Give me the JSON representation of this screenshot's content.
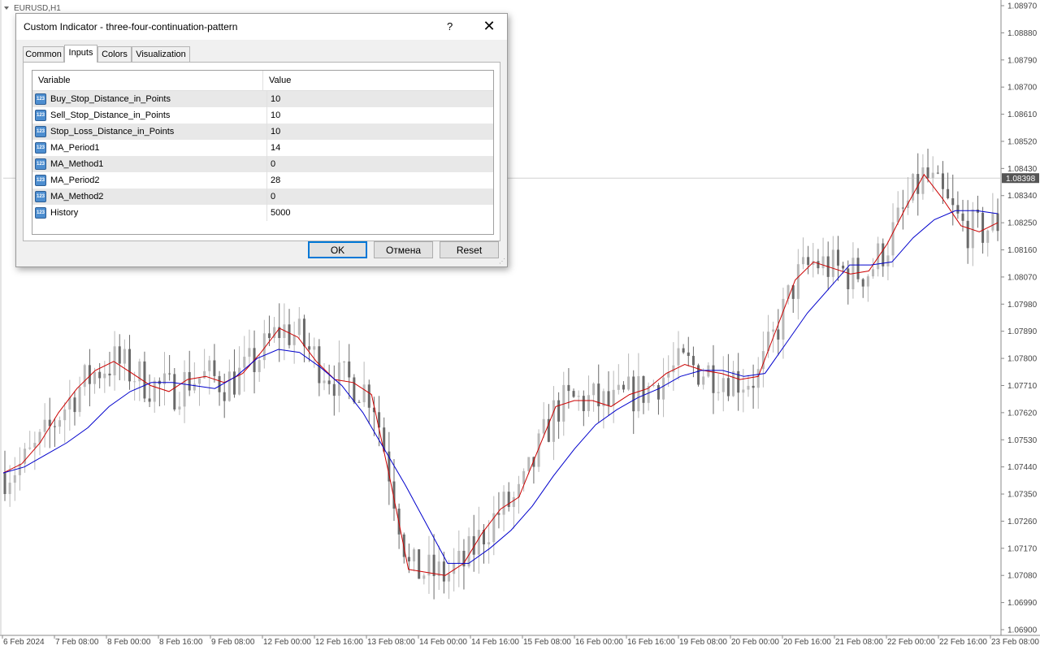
{
  "chart_window": {
    "symbol_label": "EURUSD,H1",
    "current_price": "1.08398",
    "current_price_bg": "#555555",
    "colors": {
      "ma_fast": "#cc0000",
      "ma_slow": "#0000cc",
      "bull_candle": "#b8b8b8",
      "bear_candle": "#6a6a6a",
      "axis_text": "#444444"
    }
  },
  "chart_data": {
    "type": "line",
    "price_axis_labels": [
      "1.08970",
      "1.08880",
      "1.08790",
      "1.08700",
      "1.08610",
      "1.08520",
      "1.08430",
      "1.08340",
      "1.08250",
      "1.08160",
      "1.08070",
      "1.07980",
      "1.07890",
      "1.07800",
      "1.07710",
      "1.07620",
      "1.07530",
      "1.07440",
      "1.07350",
      "1.07260",
      "1.07170",
      "1.07080",
      "1.06990",
      "1.06900"
    ],
    "ylim": [
      1.069,
      1.0897
    ],
    "time_axis_labels": [
      "6 Feb 2024",
      "7 Feb 08:00",
      "8 Feb 00:00",
      "8 Feb 16:00",
      "9 Feb 08:00",
      "12 Feb 00:00",
      "12 Feb 16:00",
      "13 Feb 08:00",
      "14 Feb 00:00",
      "14 Feb 16:00",
      "15 Feb 08:00",
      "16 Feb 00:00",
      "16 Feb 16:00",
      "19 Feb 08:00",
      "20 Feb 00:00",
      "20 Feb 16:00",
      "21 Feb 08:00",
      "22 Feb 00:00",
      "22 Feb 16:00",
      "23 Feb 08:00"
    ],
    "series": [
      {
        "values": [
          1.0742,
          1.0745,
          1.0752,
          1.0762,
          1.077,
          1.0776,
          1.0779,
          1.0775,
          1.0771,
          1.0769,
          1.0773,
          1.0774,
          1.0772,
          1.0775,
          1.0782,
          1.079,
          1.0787,
          1.0779,
          1.0773,
          1.0772,
          1.0768,
          1.074,
          1.071,
          1.0709,
          1.0708,
          1.0712,
          1.0722,
          1.073,
          1.0734,
          1.0749,
          1.0764,
          1.0766,
          1.0766,
          1.0764,
          1.0768,
          1.077,
          1.0775,
          1.0778,
          1.0776,
          1.0775,
          1.0773,
          1.0774,
          1.079,
          1.0806,
          1.0812,
          1.081,
          1.0808,
          1.0809,
          1.0818,
          1.083,
          1.0841,
          1.0833,
          1.0824,
          1.0822,
          1.0825
        ]
      },
      {
        "values": [
          1.0742,
          1.0744,
          1.0748,
          1.0752,
          1.0757,
          1.0764,
          1.0769,
          1.0772,
          1.0772,
          1.0771,
          1.077,
          1.0774,
          1.078,
          1.0783,
          1.0782,
          1.0777,
          1.0771,
          1.0762,
          1.075,
          1.0738,
          1.0725,
          1.0712,
          1.0712,
          1.0717,
          1.0723,
          1.0731,
          1.0741,
          1.075,
          1.0758,
          1.0763,
          1.0767,
          1.077,
          1.0774,
          1.0776,
          1.0776,
          1.0774,
          1.0775,
          1.0785,
          1.0795,
          1.0803,
          1.0811,
          1.0811,
          1.0812,
          1.082,
          1.0826,
          1.0829,
          1.0829,
          1.0828
        ]
      }
    ]
  },
  "dialog": {
    "title": "Custom Indicator - three-four-continuation-pattern",
    "help_label": "?",
    "close_label": "✕",
    "tabs": [
      {
        "label": "Common"
      },
      {
        "label": "Inputs"
      },
      {
        "label": "Colors"
      },
      {
        "label": "Visualization"
      }
    ],
    "active_tab": "Inputs",
    "table": {
      "col_variable": "Variable",
      "col_value": "Value",
      "icon_text": "123",
      "rows": [
        {
          "variable": "Buy_Stop_Distance_in_Points",
          "value": "10"
        },
        {
          "variable": "Sell_Stop_Distance_in_Points",
          "value": "10"
        },
        {
          "variable": "Stop_Loss_Distance_in_Points",
          "value": "10"
        },
        {
          "variable": "MA_Period1",
          "value": "14"
        },
        {
          "variable": "MA_Method1",
          "value": "0"
        },
        {
          "variable": "MA_Period2",
          "value": "28"
        },
        {
          "variable": "MA_Method2",
          "value": "0"
        },
        {
          "variable": "History",
          "value": "5000"
        }
      ]
    },
    "buttons": {
      "ok": "OK",
      "cancel": "Отмена",
      "reset": "Reset"
    }
  }
}
